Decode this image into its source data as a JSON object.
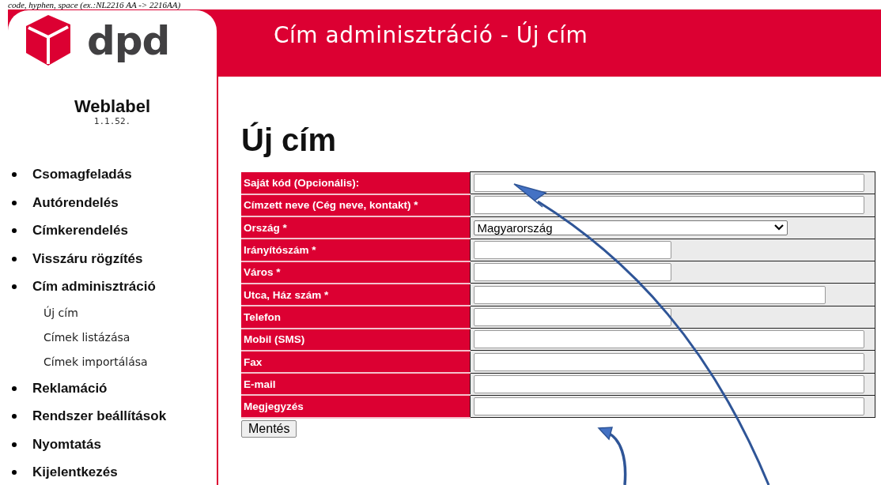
{
  "top_note": "code, hyphen, space (ex.:NL2216 AA -> 2216AA)",
  "header": {
    "logo_text": "dpd",
    "title": "Cím adminisztráció - Új cím"
  },
  "sidebar": {
    "app_name": "Weblabel",
    "version": "1.1.52.",
    "menu": [
      {
        "label": "Csomagfeladás"
      },
      {
        "label": "Autórendelés"
      },
      {
        "label": "Címkerendelés"
      },
      {
        "label": "Visszáru rögzítés"
      },
      {
        "label": "Cím adminisztráció",
        "children": [
          {
            "label": "Új cím"
          },
          {
            "label": "Címek listázása"
          },
          {
            "label": "Címek importálása"
          }
        ]
      },
      {
        "label": "Reklamáció"
      },
      {
        "label": "Rendszer beállítások"
      },
      {
        "label": "Nyomtatás"
      },
      {
        "label": "Kijelentkezés"
      }
    ]
  },
  "page_title": "Új cím",
  "form": {
    "rows": [
      {
        "label": "Saját kód (Opcionális):",
        "kind": "text"
      },
      {
        "label": "Címzett neve (Cég neve, kontakt) *",
        "kind": "text"
      },
      {
        "label": "Ország *",
        "kind": "select",
        "value": "Magyarország"
      },
      {
        "label": "Irányítószám *",
        "kind": "text"
      },
      {
        "label": "Város *",
        "kind": "text"
      },
      {
        "label": "Utca, Ház szám *",
        "kind": "text"
      },
      {
        "label": "Telefon",
        "kind": "text"
      },
      {
        "label": "Mobil (SMS)",
        "kind": "text"
      },
      {
        "label": "Fax",
        "kind": "text"
      },
      {
        "label": "E-mail",
        "kind": "text"
      },
      {
        "label": "Megjegyzés",
        "kind": "text"
      }
    ],
    "submit": "Mentés"
  }
}
